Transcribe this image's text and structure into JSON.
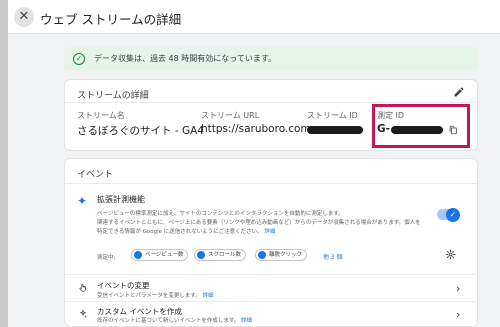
{
  "header": {
    "close_symbol": "✕",
    "title": "ウェブ ストリームの詳細"
  },
  "notice": {
    "icon": "check-circle-icon",
    "text": "データ収集は、過去 48 時間有効になっています。"
  },
  "stream_details": {
    "title": "ストリームの詳細",
    "fields": [
      {
        "label": "ストリーム名",
        "value": "さるぼろぐのサイト - GA4"
      },
      {
        "label": "ストリーム URL",
        "value": "https://saruboro.com"
      },
      {
        "label": "ストリーム ID",
        "value": ""
      },
      {
        "label": "測定 ID",
        "value": "G-"
      }
    ],
    "highlight_color": "#c2185b"
  },
  "events": {
    "title": "イベント",
    "enhanced": {
      "title": "拡張計測機能",
      "desc_line1": "ページビューの標準測定に加え、サイトのコンテンツとのインタラクションを自動的に測定します。",
      "desc_line2": "関連するイベントとともに、ページ上にある要素（リンクや埋め込み動画など）からのデータが収集される場合があります。個人を",
      "desc_line3": "特定できる情報が Google に送信されないようにご注意ください。",
      "desc_link": "詳細",
      "toggle_on": true,
      "measure_label": "測定中:",
      "chips": [
        "ページビュー数",
        "スクロール数",
        "離脱クリック"
      ],
      "more": "他 3 個"
    },
    "rows": [
      {
        "title": "イベントの変更",
        "desc": "受信イベントとパラメータを変更します。",
        "link": "詳細"
      },
      {
        "title": "カスタム イベントを作成",
        "desc": "既存のイベントに基づいて新しいイベントを作成します。",
        "link": "詳細"
      }
    ]
  },
  "colors": {
    "accent": "#1a73e8",
    "notice_bg": "#e6f4ea",
    "notice_icon": "#188038",
    "panel_bg": "#f1f3f4"
  }
}
